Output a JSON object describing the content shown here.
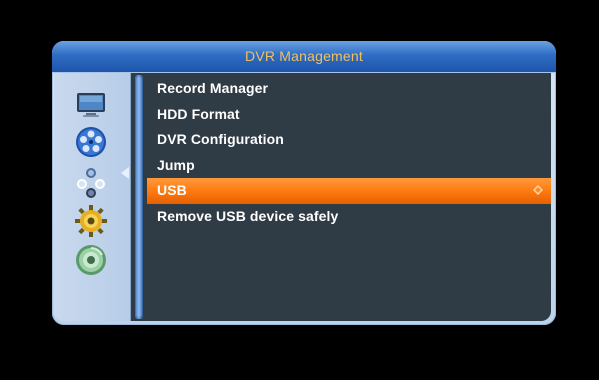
{
  "window": {
    "title": "DVR Management"
  },
  "sidebar": {
    "icons": [
      {
        "name": "tv-icon"
      },
      {
        "name": "media-reel-icon",
        "active": true
      },
      {
        "name": "network-icon"
      },
      {
        "name": "settings-gear-icon"
      },
      {
        "name": "disc-icon"
      }
    ]
  },
  "menu": {
    "items": [
      {
        "label": "Record Manager"
      },
      {
        "label": "HDD Format"
      },
      {
        "label": "DVR Configuration"
      },
      {
        "label": "Jump"
      },
      {
        "label": "USB",
        "selected": true
      },
      {
        "label": "Remove USB device safely"
      }
    ]
  },
  "colors": {
    "title_text": "#f0c060",
    "selection": "#ff7a12",
    "panel_bg": "#2f3b45",
    "title_bar": "#2f6dc4"
  }
}
